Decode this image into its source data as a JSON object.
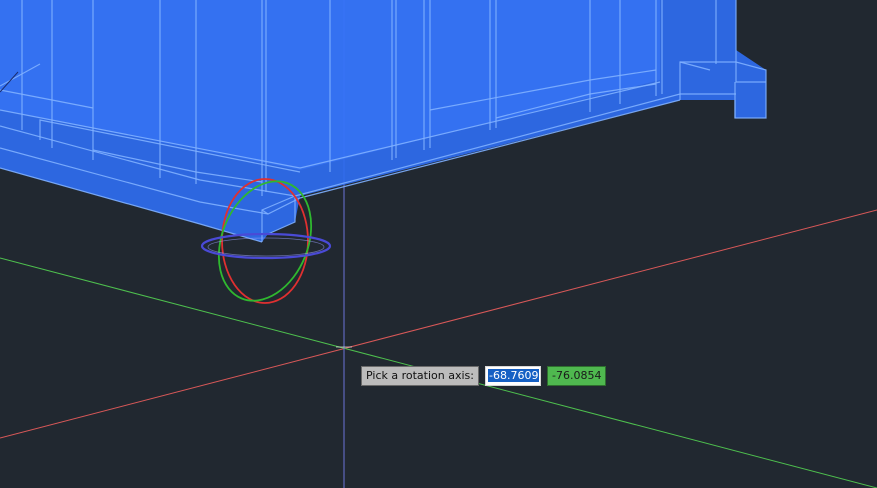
{
  "viewport": {
    "background": "#212830"
  },
  "colors": {
    "model_fill": "#2f6cf0",
    "model_edge": "#7fb0ff",
    "axis_x": "#d85858",
    "axis_y": "#4ec04e",
    "axis_z": "#5a64c8",
    "gizmo_red": "#e03030",
    "gizmo_green": "#2fb82f",
    "gizmo_blue": "#4a4ad6"
  },
  "prompt": {
    "label": "Pick a rotation axis:",
    "value_1": "-68.7609",
    "value_2": "-76.0854"
  }
}
